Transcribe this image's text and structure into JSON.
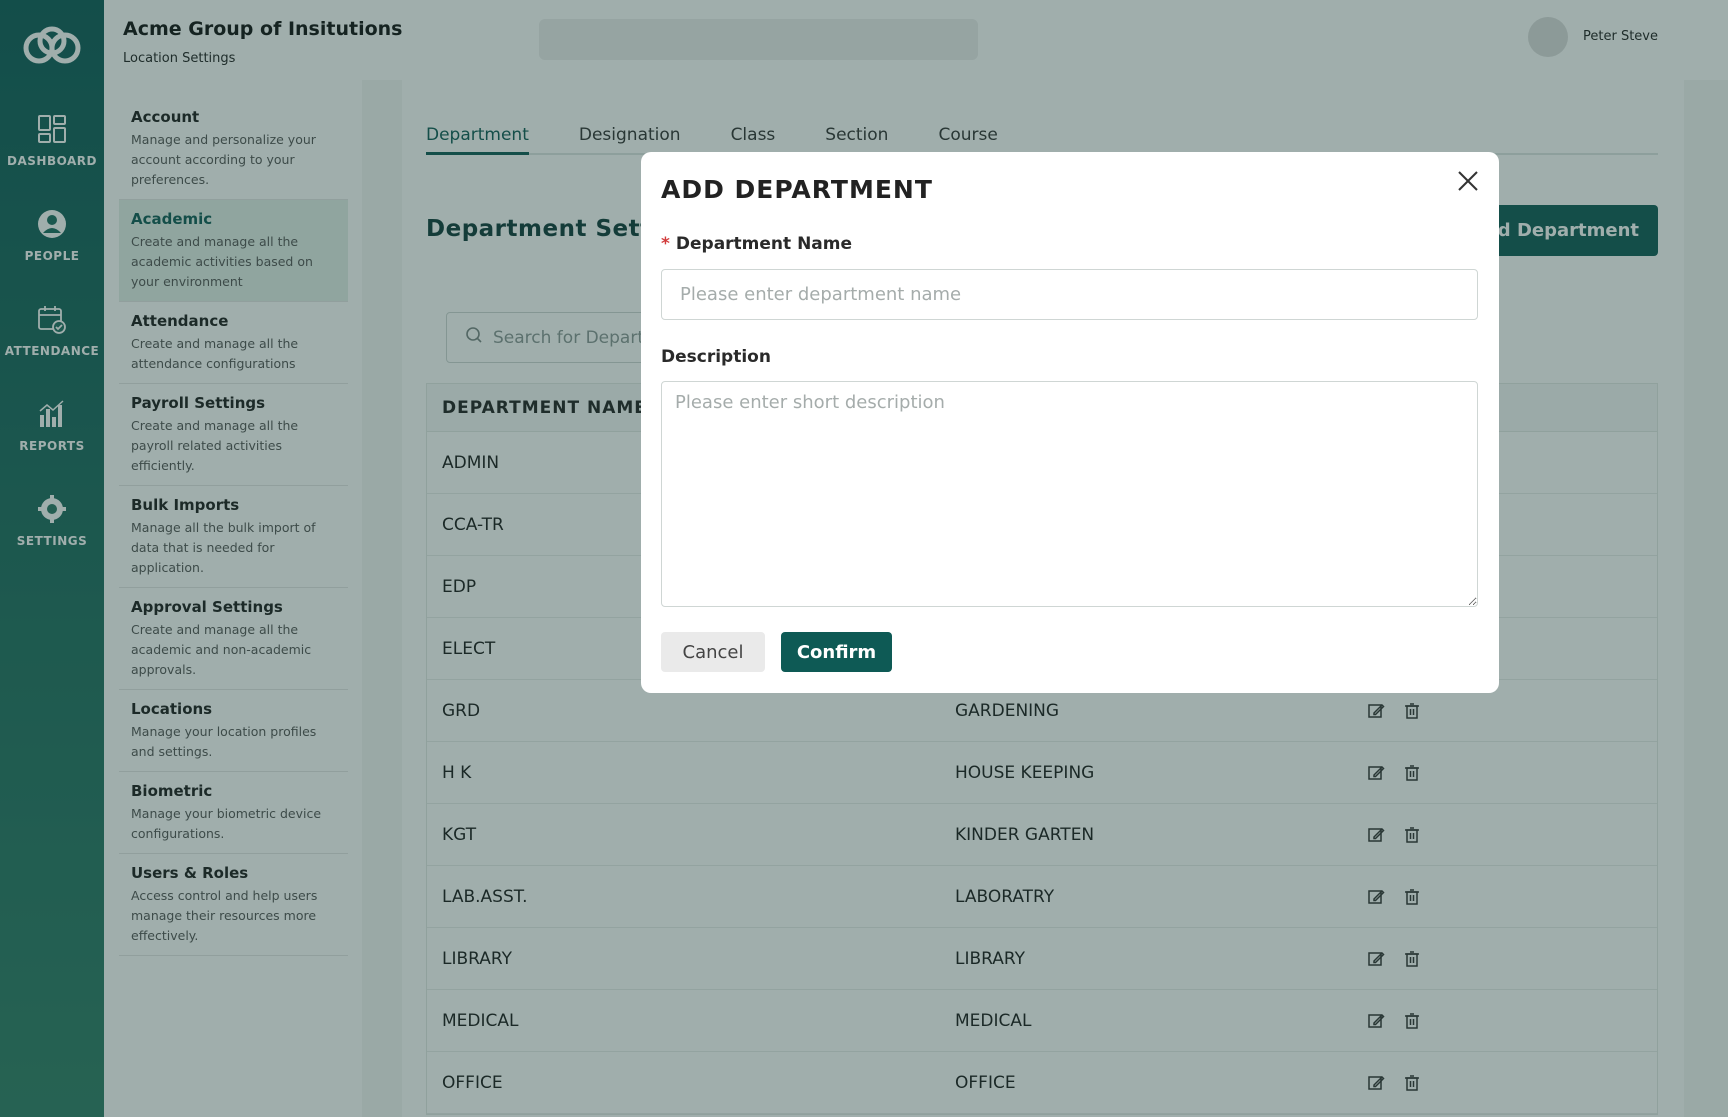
{
  "header": {
    "org_title": "Acme Group of Insitutions",
    "org_subtitle": "Location Settings",
    "user_name": "Peter Steve"
  },
  "rail": {
    "items": [
      {
        "label": "DASHBOARD",
        "icon": "dashboard-icon"
      },
      {
        "label": "PEOPLE",
        "icon": "person-icon"
      },
      {
        "label": "ATTENDANCE",
        "icon": "calendar-check-icon"
      },
      {
        "label": "REPORTS",
        "icon": "bar-chart-icon"
      },
      {
        "label": "SETTINGS",
        "icon": "gear-icon"
      }
    ]
  },
  "settings_menu": {
    "items": [
      {
        "title": "Account",
        "desc": "Manage and personalize your account according to your preferences."
      },
      {
        "title": "Academic",
        "desc": "Create and manage all the academic activities based on your environment"
      },
      {
        "title": "Attendance",
        "desc": "Create and manage all the attendance configurations"
      },
      {
        "title": "Payroll Settings",
        "desc": "Create and manage all the payroll related activities efficiently."
      },
      {
        "title": "Bulk Imports",
        "desc": "Manage all the bulk import of data that is needed for application."
      },
      {
        "title": "Approval Settings",
        "desc": "Create and manage all the academic and non-academic approvals."
      },
      {
        "title": "Locations",
        "desc": "Manage your location profiles and settings."
      },
      {
        "title": "Biometric",
        "desc": "Manage your biometric device configurations."
      },
      {
        "title": "Users & Roles",
        "desc": "Access control and help users manage their resources more effectively."
      }
    ]
  },
  "main": {
    "tabs": [
      "Department",
      "Designation",
      "Class",
      "Section",
      "Course"
    ],
    "heading": "Department Settings",
    "add_button": "Add Department",
    "search_placeholder": "Search for Department",
    "table": {
      "header": "DEPARTMENT NAME",
      "rows": [
        {
          "code": "ADMIN",
          "name": ""
        },
        {
          "code": "CCA-TR",
          "name": ""
        },
        {
          "code": "EDP",
          "name": ""
        },
        {
          "code": "ELECT",
          "name": ""
        },
        {
          "code": "GRD",
          "name": "GARDENING"
        },
        {
          "code": "H K",
          "name": "HOUSE KEEPING"
        },
        {
          "code": "KGT",
          "name": "KINDER GARTEN"
        },
        {
          "code": "LAB.ASST.",
          "name": "LABORATRY"
        },
        {
          "code": "LIBRARY",
          "name": "LIBRARY"
        },
        {
          "code": "MEDICAL",
          "name": "MEDICAL"
        },
        {
          "code": "OFFICE",
          "name": "OFFICE"
        }
      ]
    }
  },
  "modal": {
    "title": "ADD DEPARTMENT",
    "name_label": "Department Name",
    "required_mark": "*",
    "name_placeholder": "Please enter department name",
    "desc_label": "Description",
    "desc_placeholder": "Please enter short description",
    "cancel_label": "Cancel",
    "confirm_label": "Confirm"
  },
  "colors": {
    "brand": "#0e5a55",
    "rail_top": "#0d5a57",
    "rail_bottom": "#2e7d66",
    "required": "#d23c3c"
  }
}
